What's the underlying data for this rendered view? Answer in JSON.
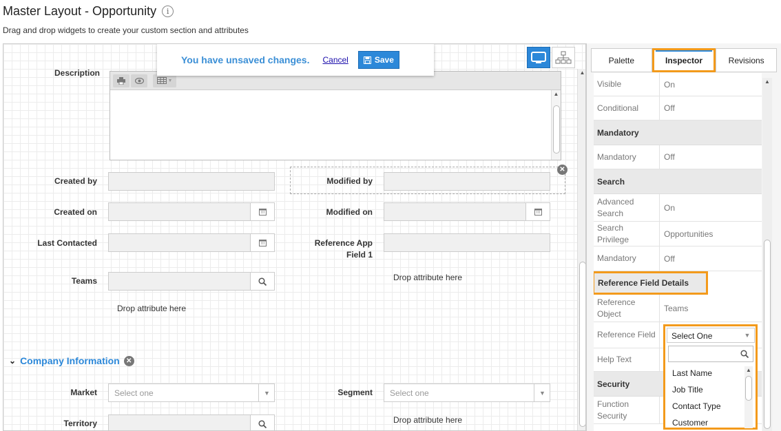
{
  "header": {
    "title": "Master Layout - Opportunity",
    "subtitle": "Drag and drop widgets to create your custom section and attributes"
  },
  "unsaved_bar": {
    "message": "You have unsaved changes.",
    "cancel_label": "Cancel",
    "save_label": "Save"
  },
  "form": {
    "description_label": "Description",
    "created_by_label": "Created by",
    "modified_by_label": "Modified by",
    "created_on_label": "Created on",
    "modified_on_label": "Modified on",
    "last_contacted_label": "Last Contacted",
    "reference_app_label": "Reference App Field 1",
    "teams_label": "Teams",
    "drop_text": "Drop attribute here",
    "section_title": "Company Information",
    "market_label": "Market",
    "market_placeholder": "Select one",
    "segment_label": "Segment",
    "segment_placeholder": "Select one",
    "territory_label": "Territory"
  },
  "panel": {
    "tabs": [
      "Palette",
      "Inspector",
      "Revisions"
    ],
    "active_tab": "Inspector",
    "visible_label": "Visible",
    "visible_value": "On",
    "conditional_label": "Conditional",
    "conditional_value": "Off",
    "mandatory_group": "Mandatory",
    "mandatory_label": "Mandatory",
    "mandatory_value": "Off",
    "search_group": "Search",
    "advanced_search_label": "Advanced Search",
    "advanced_search_value": "On",
    "search_privilege_label": "Search Privilege",
    "search_privilege_value": "Opportunities",
    "search_mandatory_label": "Mandatory",
    "search_mandatory_value": "Off",
    "ref_group": "Reference Field Details",
    "ref_object_label": "Reference Object",
    "ref_object_value": "Teams",
    "ref_field_label": "Reference Field",
    "help_text_label": "Help Text",
    "security_group": "Security",
    "function_security_label": "Function Security"
  },
  "ref_dropdown": {
    "selected": "Select One",
    "options": [
      "Last Name",
      "Job Title",
      "Contact Type",
      "Customer"
    ]
  },
  "colors": {
    "accent": "#2c88d9",
    "highlight": "#f39a1b"
  }
}
